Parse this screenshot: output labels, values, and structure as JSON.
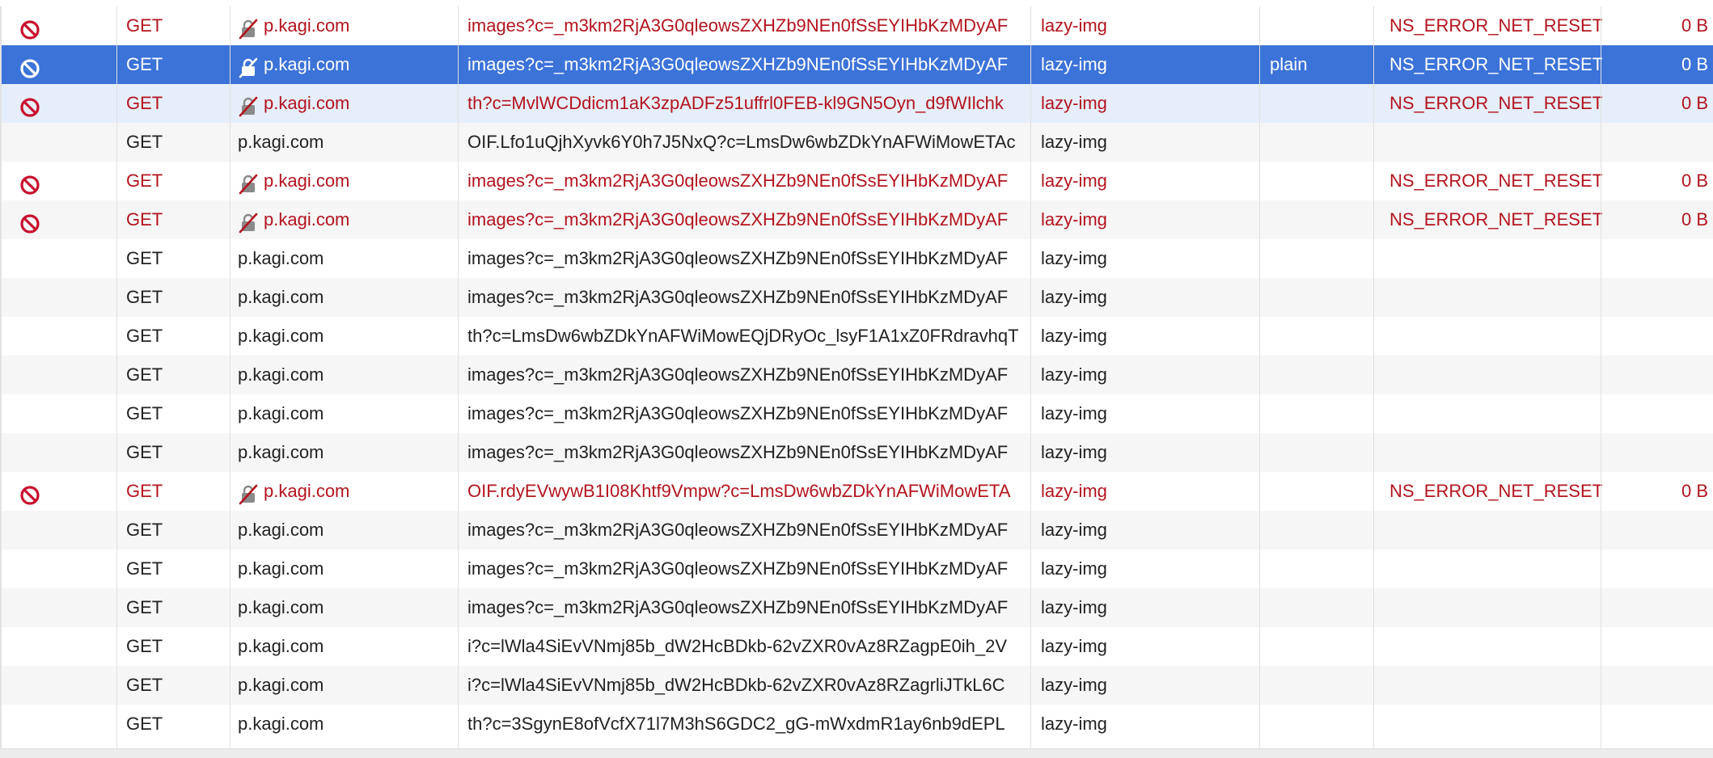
{
  "requests": [
    {
      "blocked": true,
      "insecure": true,
      "method": "GET",
      "domain": "p.kagi.com",
      "file": "images?c=_m3km2RjA3G0qleowsZXHZb9NEn0fSsEYIHbKzMDyAF",
      "initiator": "lazy-img",
      "type": "",
      "transferred": "NS_ERROR_NET_RESET",
      "size": "0 B",
      "state": "error"
    },
    {
      "blocked": true,
      "insecure": true,
      "method": "GET",
      "domain": "p.kagi.com",
      "file": "images?c=_m3km2RjA3G0qleowsZXHZb9NEn0fSsEYIHbKzMDyAF",
      "initiator": "lazy-img",
      "type": "plain",
      "transferred": "NS_ERROR_NET_RESET",
      "size": "0 B",
      "state": "selected"
    },
    {
      "blocked": true,
      "insecure": true,
      "method": "GET",
      "domain": "p.kagi.com",
      "file": "th?c=MvlWCDdicm1aK3zpADFz51uffrl0FEB-kl9GN5Oyn_d9fWIlchk",
      "initiator": "lazy-img",
      "type": "",
      "transferred": "NS_ERROR_NET_RESET",
      "size": "0 B",
      "state": "error-highlight"
    },
    {
      "blocked": false,
      "insecure": false,
      "method": "GET",
      "domain": "p.kagi.com",
      "file": "OIF.Lfo1uQjhXyvk6Y0h7J5NxQ?c=LmsDw6wbZDkYnAFWiMowETAc",
      "initiator": "lazy-img",
      "type": "",
      "transferred": "",
      "size": "",
      "state": "normal"
    },
    {
      "blocked": true,
      "insecure": true,
      "method": "GET",
      "domain": "p.kagi.com",
      "file": "images?c=_m3km2RjA3G0qleowsZXHZb9NEn0fSsEYIHbKzMDyAF",
      "initiator": "lazy-img",
      "type": "",
      "transferred": "NS_ERROR_NET_RESET",
      "size": "0 B",
      "state": "error"
    },
    {
      "blocked": true,
      "insecure": true,
      "method": "GET",
      "domain": "p.kagi.com",
      "file": "images?c=_m3km2RjA3G0qleowsZXHZb9NEn0fSsEYIHbKzMDyAF",
      "initiator": "lazy-img",
      "type": "",
      "transferred": "NS_ERROR_NET_RESET",
      "size": "0 B",
      "state": "error"
    },
    {
      "blocked": false,
      "insecure": false,
      "method": "GET",
      "domain": "p.kagi.com",
      "file": "images?c=_m3km2RjA3G0qleowsZXHZb9NEn0fSsEYIHbKzMDyAF",
      "initiator": "lazy-img",
      "type": "",
      "transferred": "",
      "size": "",
      "state": "normal"
    },
    {
      "blocked": false,
      "insecure": false,
      "method": "GET",
      "domain": "p.kagi.com",
      "file": "images?c=_m3km2RjA3G0qleowsZXHZb9NEn0fSsEYIHbKzMDyAF",
      "initiator": "lazy-img",
      "type": "",
      "transferred": "",
      "size": "",
      "state": "normal"
    },
    {
      "blocked": false,
      "insecure": false,
      "method": "GET",
      "domain": "p.kagi.com",
      "file": "th?c=LmsDw6wbZDkYnAFWiMowEQjDRyOc_lsyF1A1xZ0FRdravhqT",
      "initiator": "lazy-img",
      "type": "",
      "transferred": "",
      "size": "",
      "state": "normal"
    },
    {
      "blocked": false,
      "insecure": false,
      "method": "GET",
      "domain": "p.kagi.com",
      "file": "images?c=_m3km2RjA3G0qleowsZXHZb9NEn0fSsEYIHbKzMDyAF",
      "initiator": "lazy-img",
      "type": "",
      "transferred": "",
      "size": "",
      "state": "normal"
    },
    {
      "blocked": false,
      "insecure": false,
      "method": "GET",
      "domain": "p.kagi.com",
      "file": "images?c=_m3km2RjA3G0qleowsZXHZb9NEn0fSsEYIHbKzMDyAF",
      "initiator": "lazy-img",
      "type": "",
      "transferred": "",
      "size": "",
      "state": "normal"
    },
    {
      "blocked": false,
      "insecure": false,
      "method": "GET",
      "domain": "p.kagi.com",
      "file": "images?c=_m3km2RjA3G0qleowsZXHZb9NEn0fSsEYIHbKzMDyAF",
      "initiator": "lazy-img",
      "type": "",
      "transferred": "",
      "size": "",
      "state": "normal"
    },
    {
      "blocked": true,
      "insecure": true,
      "method": "GET",
      "domain": "p.kagi.com",
      "file": "OIF.rdyEVwywB1I08Khtf9Vmpw?c=LmsDw6wbZDkYnAFWiMowETA",
      "initiator": "lazy-img",
      "type": "",
      "transferred": "NS_ERROR_NET_RESET",
      "size": "0 B",
      "state": "error"
    },
    {
      "blocked": false,
      "insecure": false,
      "method": "GET",
      "domain": "p.kagi.com",
      "file": "images?c=_m3km2RjA3G0qleowsZXHZb9NEn0fSsEYIHbKzMDyAF",
      "initiator": "lazy-img",
      "type": "",
      "transferred": "",
      "size": "",
      "state": "normal"
    },
    {
      "blocked": false,
      "insecure": false,
      "method": "GET",
      "domain": "p.kagi.com",
      "file": "images?c=_m3km2RjA3G0qleowsZXHZb9NEn0fSsEYIHbKzMDyAF",
      "initiator": "lazy-img",
      "type": "",
      "transferred": "",
      "size": "",
      "state": "normal"
    },
    {
      "blocked": false,
      "insecure": false,
      "method": "GET",
      "domain": "p.kagi.com",
      "file": "images?c=_m3km2RjA3G0qleowsZXHZb9NEn0fSsEYIHbKzMDyAF",
      "initiator": "lazy-img",
      "type": "",
      "transferred": "",
      "size": "",
      "state": "normal"
    },
    {
      "blocked": false,
      "insecure": false,
      "method": "GET",
      "domain": "p.kagi.com",
      "file": "i?c=lWla4SiEvVNmj85b_dW2HcBDkb-62vZXR0vAz8RZagpE0ih_2V",
      "initiator": "lazy-img",
      "type": "",
      "transferred": "",
      "size": "",
      "state": "normal"
    },
    {
      "blocked": false,
      "insecure": false,
      "method": "GET",
      "domain": "p.kagi.com",
      "file": "i?c=lWla4SiEvVNmj85b_dW2HcBDkb-62vZXR0vAz8RZagrliJTkL6C",
      "initiator": "lazy-img",
      "type": "",
      "transferred": "",
      "size": "",
      "state": "normal"
    },
    {
      "blocked": false,
      "insecure": false,
      "method": "GET",
      "domain": "p.kagi.com",
      "file": "th?c=3SgynE8ofVcfX71l7M3hS6GDC2_gG-mWxdmR1ay6nb9dEPL",
      "initiator": "lazy-img",
      "type": "",
      "transferred": "",
      "size": "",
      "state": "normal"
    }
  ],
  "colors": {
    "error_text": "#b3141e",
    "selected_bg": "#3b73d9",
    "highlight_bg": "#e6eefb",
    "zebra_bg": "#f6f6f6",
    "block_icon": "#c8102e"
  },
  "icons": {
    "blocked": "block-icon",
    "insecure": "insecure-connection-icon"
  }
}
